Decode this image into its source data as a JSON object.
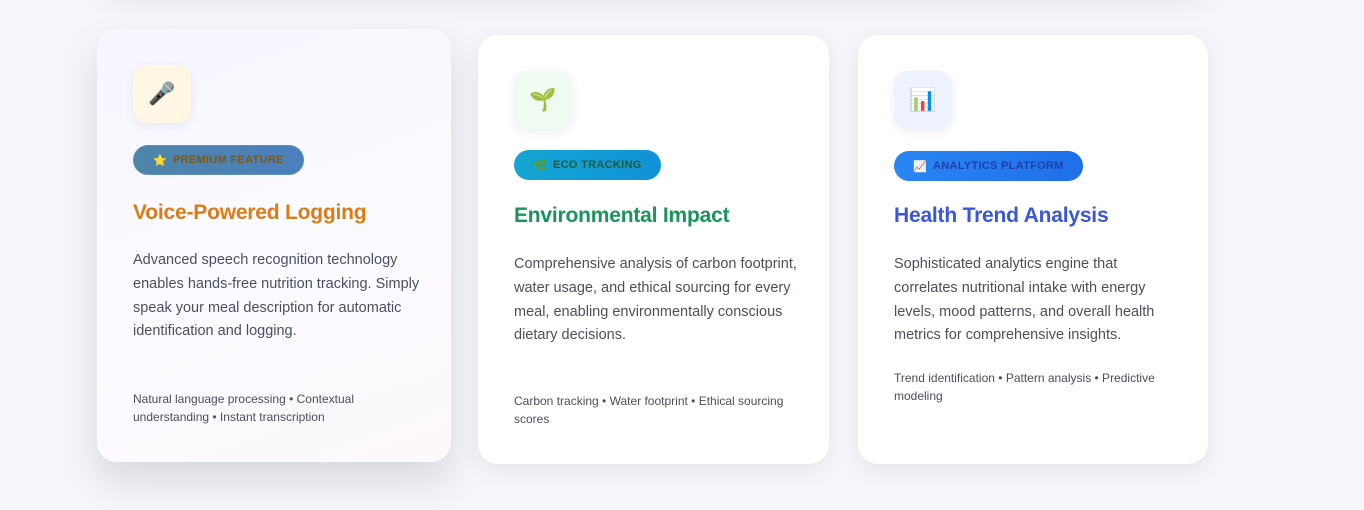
{
  "cards": [
    {
      "icon": "microphone-icon",
      "icon_glyph": "🎤",
      "badge_icon": "⭐",
      "badge": "PREMIUM FEATURE",
      "title": "Voice-Powered Logging",
      "description": "Advanced speech recognition technology enables hands-free nutrition tracking. Simply speak your meal description for automatic identification and logging.",
      "features": "Natural language processing • Contextual understanding • Instant transcription",
      "accent": "#dd7b16"
    },
    {
      "icon": "seedling-icon",
      "icon_glyph": "🌱",
      "badge_icon": "🌿",
      "badge": "ECO TRACKING",
      "title": "Environmental Impact",
      "description": "Comprehensive analysis of carbon footprint, water usage, and ethical sourcing for every meal, enabling environmentally conscious dietary decisions.",
      "features": "Carbon tracking • Water footprint • Ethical sourcing scores",
      "accent": "#18955a"
    },
    {
      "icon": "bar-chart-icon",
      "icon_glyph": "📊",
      "badge_icon": "📈",
      "badge": "ANALYTICS PLATFORM",
      "title": "Health Trend Analysis",
      "description": "Sophisticated analytics engine that correlates nutritional intake with energy levels, mood patterns, and overall health metrics for comprehensive insights.",
      "features": "Trend identification • Pattern analysis • Predictive modeling",
      "accent": "#3a57dc"
    }
  ]
}
